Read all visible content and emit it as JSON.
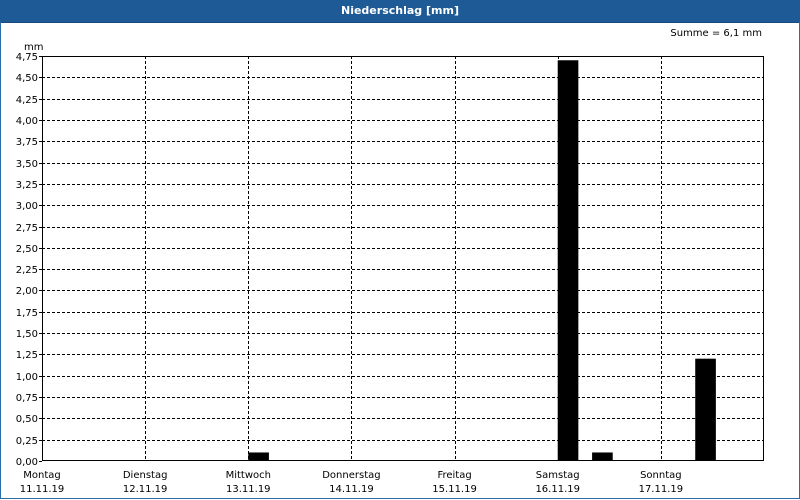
{
  "window": {
    "title": "Niederschlag [mm]"
  },
  "colors": {
    "titlebar": "#1e5b96",
    "bar": "#000000",
    "grid": "#000000",
    "background": "#ffffff"
  },
  "chart_data": {
    "type": "bar",
    "title": "Niederschlag [mm]",
    "summary": "Summe = 6,1 mm",
    "y_unit": "mm",
    "xlabel": "",
    "ylabel": "",
    "ylim": [
      0,
      4.75
    ],
    "ytick_step": 0.25,
    "yticks": [
      "0,00",
      "0,25",
      "0,50",
      "0,75",
      "1,00",
      "1,25",
      "1,50",
      "1,75",
      "2,00",
      "2,25",
      "2,50",
      "2,75",
      "3,00",
      "3,25",
      "3,50",
      "3,75",
      "4,00",
      "4,25",
      "4,50",
      "4,75"
    ],
    "grid": true,
    "legend": "none",
    "xlim": [
      "2019-11-11 00:00",
      "2019-11-18 00:00"
    ],
    "days": [
      {
        "name": "Montag",
        "date": "11.11.19"
      },
      {
        "name": "Dienstag",
        "date": "12.11.19"
      },
      {
        "name": "Mittwoch",
        "date": "13.11.19"
      },
      {
        "name": "Donnerstag",
        "date": "14.11.19"
      },
      {
        "name": "Freitag",
        "date": "15.11.19"
      },
      {
        "name": "Samstag",
        "date": "16.11.19"
      },
      {
        "name": "Sonntag",
        "date": "17.11.19"
      }
    ],
    "series": [
      {
        "points": [
          {
            "x": "2019-11-13 00:00",
            "y": 0.1
          },
          {
            "x": "2019-11-16 00:00",
            "y": 4.7
          },
          {
            "x": "2019-11-16 08:00",
            "y": 0.1
          },
          {
            "x": "2019-11-17 08:00",
            "y": 1.2
          }
        ]
      }
    ]
  }
}
